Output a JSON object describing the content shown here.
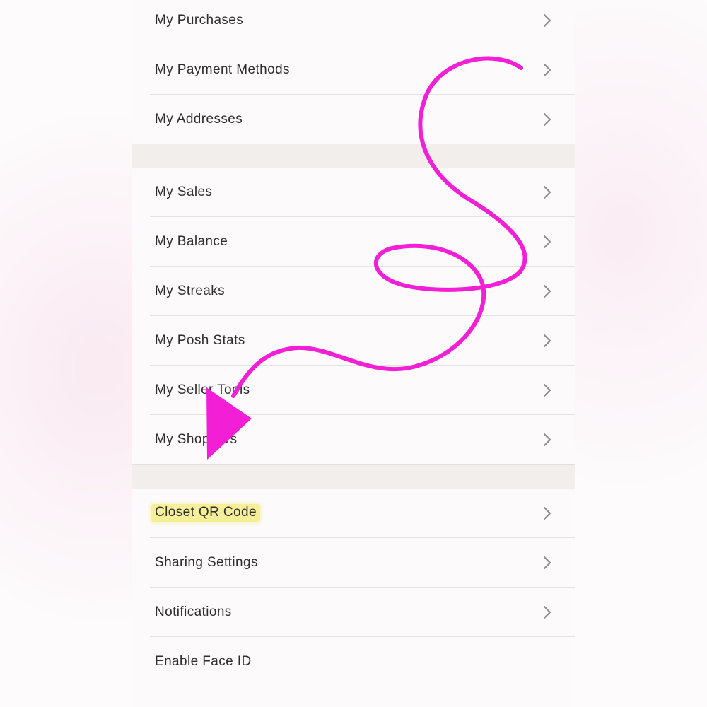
{
  "menu": {
    "group1": [
      {
        "label": "My Purchases",
        "chevron": true
      },
      {
        "label": "My Payment Methods",
        "chevron": true
      },
      {
        "label": "My Addresses",
        "chevron": true
      }
    ],
    "group2": [
      {
        "label": "My Sales",
        "chevron": true
      },
      {
        "label": "My Balance",
        "chevron": true
      },
      {
        "label": "My Streaks",
        "chevron": true
      },
      {
        "label": "My Posh Stats",
        "chevron": true
      },
      {
        "label": "My Seller Tools",
        "chevron": true
      },
      {
        "label": "My Shoppers",
        "chevron": true
      }
    ],
    "group3": [
      {
        "label": "Closet QR Code",
        "chevron": true,
        "highlighted": true
      },
      {
        "label": "Sharing Settings",
        "chevron": true
      },
      {
        "label": "Notifications",
        "chevron": true
      },
      {
        "label": "Enable Face ID",
        "chevron": false
      }
    ]
  },
  "icons": {
    "row_chevron": "chevron-right-icon",
    "annotation": "magenta-arrow-scribble"
  },
  "colors": {
    "annotation_magenta": "#f21fd6",
    "highlight_yellow": "#f6ef9a",
    "section_gap": "#f1eeec",
    "text": "#2d2d2d",
    "chevron": "#8e8e8e"
  }
}
